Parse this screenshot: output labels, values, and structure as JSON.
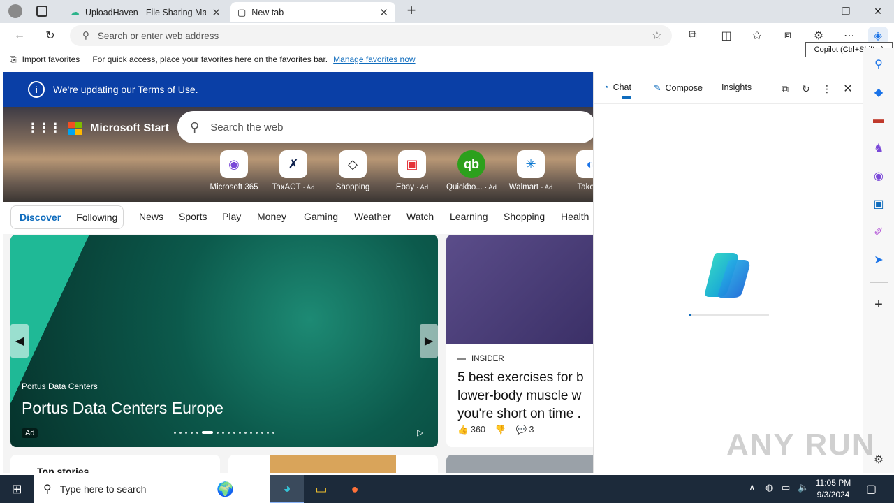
{
  "browser": {
    "tabs": [
      {
        "title": "UploadHaven - File Sharing Made"
      },
      {
        "title": "New tab"
      }
    ],
    "address_placeholder": "Search or enter web address",
    "favorites_bar": {
      "import_label": "Import favorites",
      "hint": "For quick access, place your favorites here on the favorites bar.",
      "manage_link": "Manage favorites now"
    },
    "tooltip": "Copilot (Ctrl+Shift+.)"
  },
  "page": {
    "terms_notice": "We're updating our Terms of Use.",
    "brand": "Microsoft Start",
    "search_placeholder": "Search the web",
    "quick_links": [
      {
        "label": "Microsoft 365",
        "ad": ""
      },
      {
        "label": "TaxACT",
        "ad": "· Ad"
      },
      {
        "label": "Shopping",
        "ad": ""
      },
      {
        "label": "Ebay",
        "ad": "· Ad"
      },
      {
        "label": "Quickbo...",
        "ad": "· Ad"
      },
      {
        "label": "Walmart",
        "ad": "· Ad"
      },
      {
        "label": "TakeLe",
        "ad": ""
      }
    ],
    "feed_tabs": [
      "Discover",
      "Following"
    ],
    "nav": [
      "News",
      "Sports",
      "Play",
      "Money",
      "Gaming",
      "Weather",
      "Watch",
      "Learning",
      "Shopping",
      "Health"
    ],
    "main_card": {
      "source": "Portus Data Centers",
      "title": "Portus Data Centers Europe",
      "badge": "Ad"
    },
    "side_card": {
      "source": "INSIDER",
      "title": "5 best exercises for b lower-body muscle w you're short on time .",
      "likes": "360",
      "comments": "3"
    },
    "bottom_card_label": "Top stories"
  },
  "copilot": {
    "tabs": [
      "Chat",
      "Compose",
      "Insights"
    ]
  },
  "taskbar": {
    "search_placeholder": "Type here to search",
    "time": "11:05 PM",
    "date": "9/3/2024"
  },
  "watermark": "ANY RUN"
}
